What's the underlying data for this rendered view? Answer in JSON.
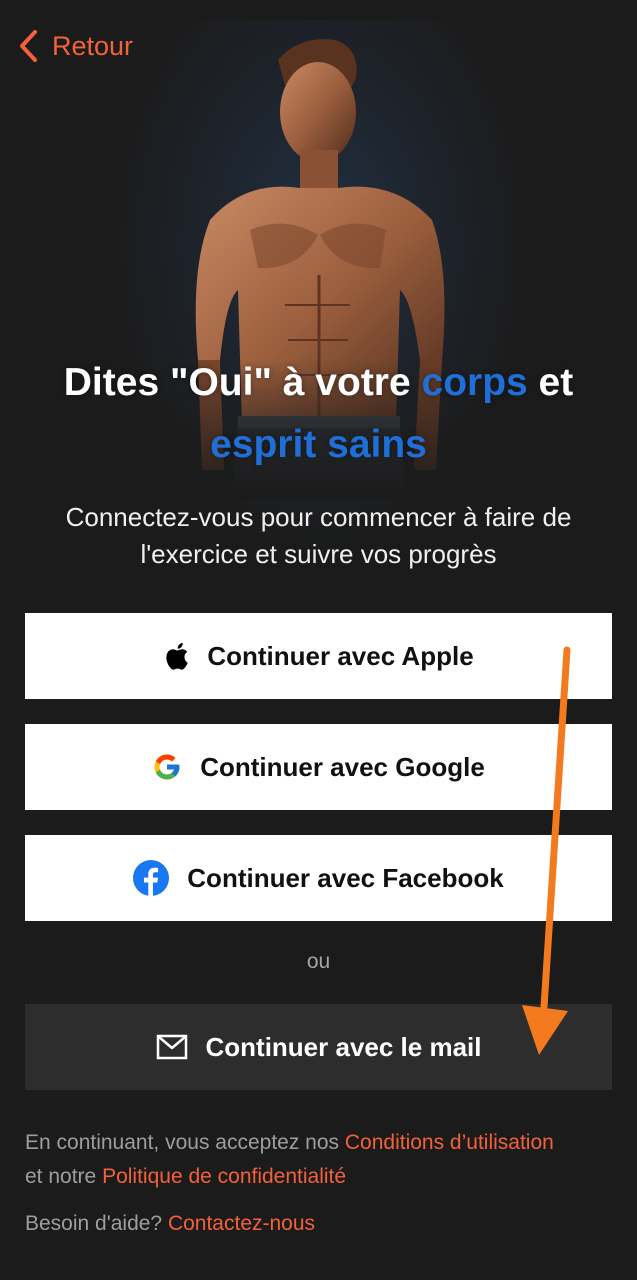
{
  "nav": {
    "back_label": "Retour"
  },
  "hero": {
    "image": "muscular-man-illustration"
  },
  "headline": {
    "part1": "Dites \"Oui\" à votre ",
    "accent1": "corps",
    "part2": " et",
    "accent2": "esprit sains"
  },
  "subtitle": {
    "line1": "Connectez-vous pour commencer à faire de",
    "line2": "l'exercice et suivre vos progrès"
  },
  "buttons": {
    "apple": {
      "label": "Continuer avec Apple",
      "icon": "apple-icon"
    },
    "google": {
      "label": "Continuer avec Google",
      "icon": "google-icon"
    },
    "facebook": {
      "label": "Continuer avec Facebook",
      "icon": "facebook-icon"
    },
    "mail": {
      "label": "Continuer avec le mail",
      "icon": "mail-icon"
    }
  },
  "divider": {
    "or": "ou"
  },
  "legal": {
    "prefix": "En continuant, vous acceptez nos ",
    "terms": "Conditions d’utilisation",
    "middle": "et notre ",
    "privacy": "Politique de confidentialité"
  },
  "help": {
    "prefix": "Besoin d'aide? ",
    "contact": "Contactez-nous"
  },
  "colors": {
    "background": "#1b1b1b",
    "accent_orange": "#f2613a",
    "accent_blue": "#1f6fd6",
    "annotation_arrow": "#f47a1f"
  }
}
